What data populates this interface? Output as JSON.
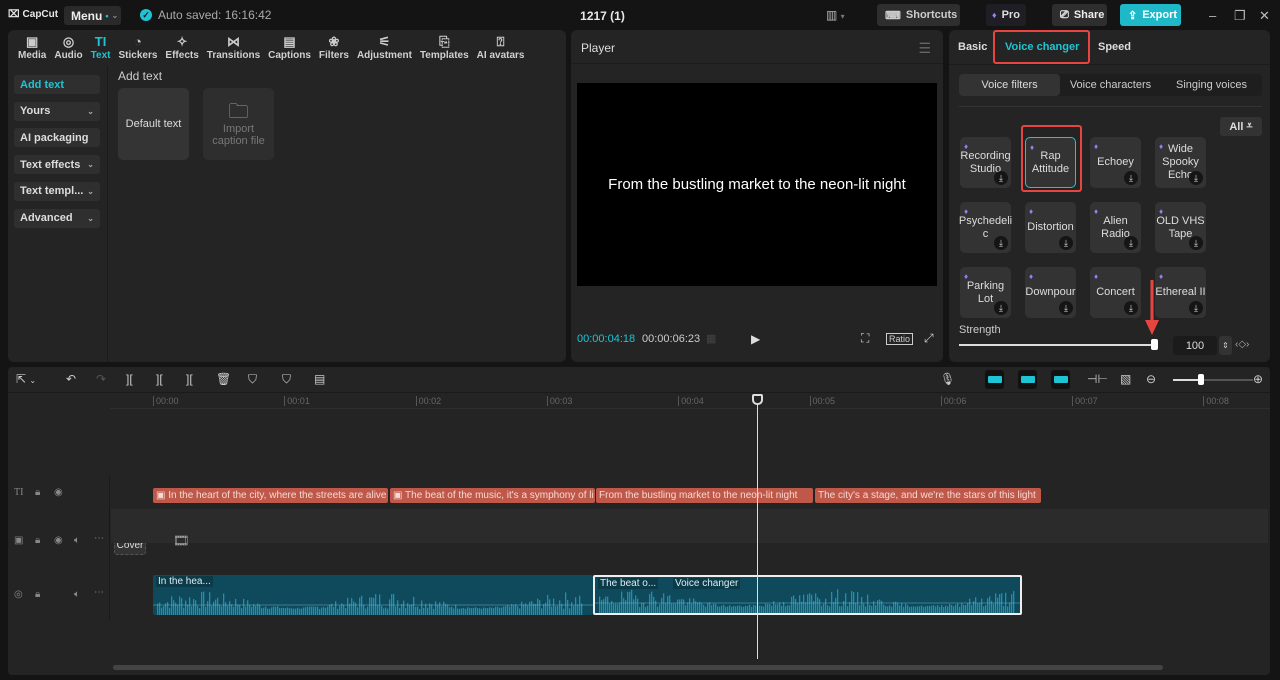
{
  "titlebar": {
    "logo": "CapCut",
    "menu_label": "Menu",
    "autosave": "Auto saved: 16:16:42",
    "project_title": "1217 (1)",
    "shortcuts": "Shortcuts",
    "pro": "Pro",
    "share": "Share",
    "export": "Export"
  },
  "toolbar": [
    {
      "label": "Media",
      "icon": "▣"
    },
    {
      "label": "Audio",
      "icon": "◎"
    },
    {
      "label": "Text",
      "icon": "TI"
    },
    {
      "label": "Stickers",
      "icon": "◔"
    },
    {
      "label": "Effects",
      "icon": "✧"
    },
    {
      "label": "Transitions",
      "icon": "⋈"
    },
    {
      "label": "Captions",
      "icon": "▤"
    },
    {
      "label": "Filters",
      "icon": "❀"
    },
    {
      "label": "Adjustment",
      "icon": "⚟"
    },
    {
      "label": "Templates",
      "icon": "⎘"
    },
    {
      "label": "AI avatars",
      "icon": "⍰"
    }
  ],
  "text_sidebar": [
    {
      "label": "Add text",
      "chevron": ""
    },
    {
      "label": "Yours",
      "chevron": "⌄"
    },
    {
      "label": "AI packaging",
      "chevron": ""
    },
    {
      "label": "Text effects",
      "chevron": "⌄"
    },
    {
      "label": "Text templ...",
      "chevron": "⌄"
    },
    {
      "label": "Advanced",
      "chevron": "⌄"
    }
  ],
  "add_text": {
    "title": "Add text",
    "default_card": "Default text",
    "import_card_line1": "Import",
    "import_card_line2": "caption file"
  },
  "player": {
    "title": "Player",
    "caption": "From the bustling market to the neon-lit night",
    "current_time": "00:00:04:18",
    "total_time": "00:00:06:23",
    "ratio": "Ratio"
  },
  "right_panel": {
    "tabs": [
      "Basic",
      "Voice changer",
      "Speed"
    ],
    "subtabs": [
      "Voice filters",
      "Voice characters",
      "Singing voices"
    ],
    "filter_button": "All",
    "voice_filters": [
      "Recording Studio",
      "Rap Attitude",
      "Echoey",
      "Wide Spooky Echo",
      "Psychedeli c",
      "Distortion",
      "Alien Radio",
      "OLD VHS Tape",
      "Parking Lot",
      "Downpour",
      "Concert",
      "Ethereal II"
    ],
    "selected_filter": "Rap Attitude",
    "strength_label": "Strength",
    "strength_value": "100",
    "strength_fraction": 1.0
  },
  "timeline": {
    "ruler": [
      "00:00",
      "00:01",
      "00:02",
      "00:03",
      "00:04",
      "00:05",
      "00:06",
      "00:07",
      "00:08"
    ],
    "text_clips": [
      "In the heart of the city, where the streets are alive",
      "The beat of the music, it's a symphony of li",
      "From the bustling market to the neon-lit night",
      "The city's a stage, and we're the stars of this light"
    ],
    "cover_label": "Cover",
    "audio_clips": [
      {
        "label": "In the hea...",
        "effect": ""
      },
      {
        "label": "The beat o...",
        "effect": "Voice changer"
      }
    ],
    "zoom_fraction": 0.35
  },
  "colors": {
    "accent": "#1fc4d4",
    "highlight": "#e6463f",
    "text_clip": "#c0584a",
    "audio_clip": "#0e4a5c"
  }
}
